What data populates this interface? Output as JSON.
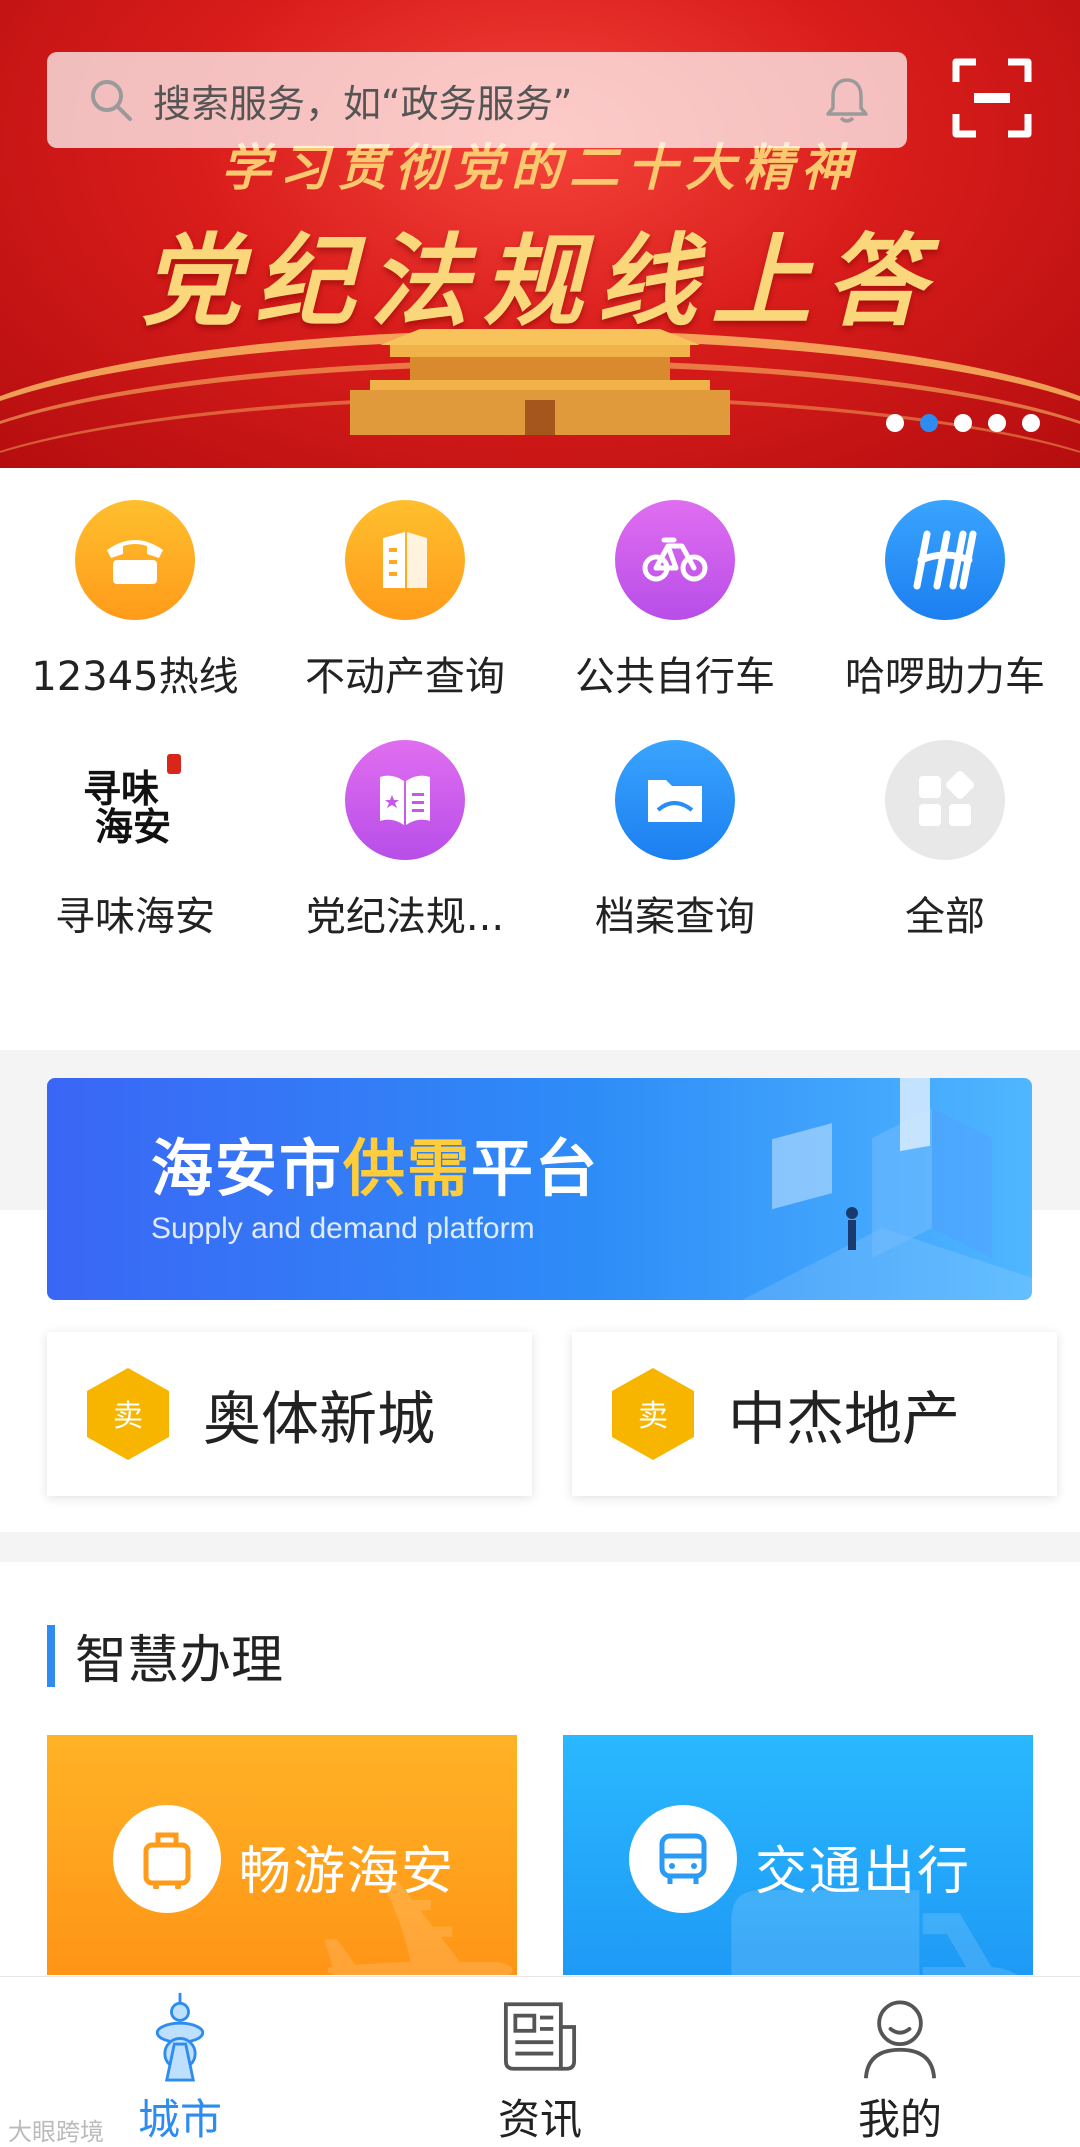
{
  "banner": {
    "subtitle": "学习贯彻党的二十大精神",
    "title": "党纪法规线上答",
    "slides_total": 5,
    "active_slide": 2
  },
  "search": {
    "placeholder": "搜索服务，如“政务服务”",
    "search_icon": "search-icon",
    "bell_icon": "bell-icon",
    "scan_icon": "scan-icon"
  },
  "services": [
    {
      "label": "12345热线",
      "icon": "phone-icon"
    },
    {
      "label": "不动产查询",
      "icon": "building-icon"
    },
    {
      "label": "公共自行车",
      "icon": "bicycle-icon"
    },
    {
      "label": "哈啰助力车",
      "icon": "hellobike-icon"
    },
    {
      "label": "寻味海安",
      "icon": "xunwei-logo-icon",
      "logo_text": "寻味海安"
    },
    {
      "label": "党纪法规...",
      "icon": "book-icon"
    },
    {
      "label": "档案查询",
      "icon": "folder-icon"
    },
    {
      "label": "全部",
      "icon": "all-apps-icon"
    }
  ],
  "supply_banner": {
    "title_part1": "海安市",
    "title_highlight": "供需",
    "title_part2": "平台",
    "subtitle": "Supply and demand platform"
  },
  "sale_cards": [
    {
      "badge": "卖",
      "name": "奥体新城"
    },
    {
      "badge": "卖",
      "name": "中杰地产"
    }
  ],
  "smart_section": {
    "title": "智慧办理",
    "cards": [
      {
        "name": "畅游海安",
        "icon": "luggage-icon"
      },
      {
        "name": "交通出行",
        "icon": "bus-icon"
      }
    ]
  },
  "bottom_nav": [
    {
      "label": "城市",
      "icon": "city-tower-icon",
      "active": true
    },
    {
      "label": "资讯",
      "icon": "news-icon",
      "active": false
    },
    {
      "label": "我的",
      "icon": "profile-icon",
      "active": false
    }
  ],
  "watermark": "大眼跨境",
  "colors": {
    "accent": "#2e8cf0",
    "banner_red": "#d91d1b",
    "gold": "#fbd77c",
    "orange": "#ff9b1a",
    "purple": "#c857ea",
    "sale_yellow": "#f5b800"
  }
}
